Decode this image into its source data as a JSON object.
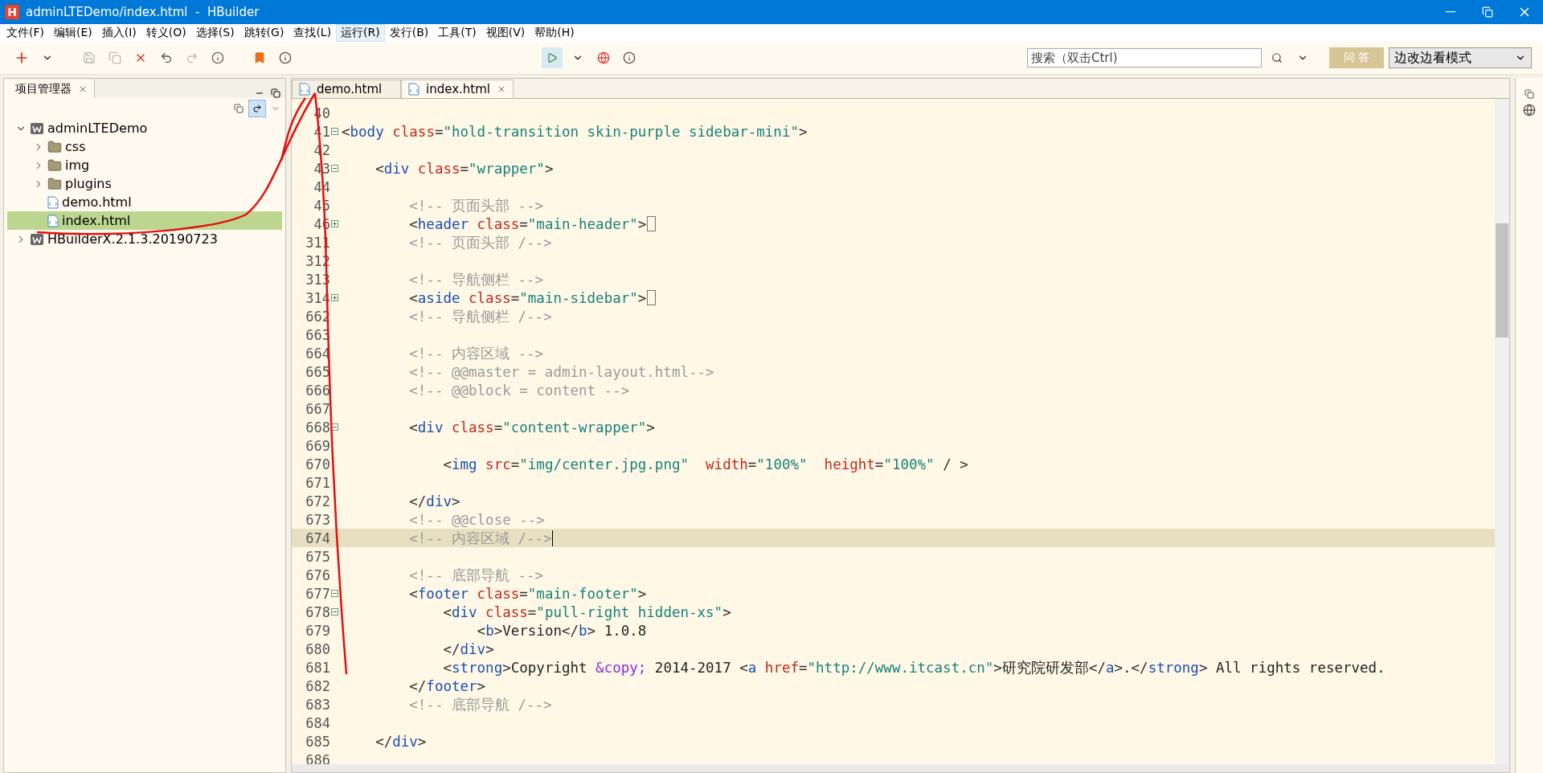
{
  "window": {
    "logo": "H",
    "title": "adminLTEDemo/index.html  -  HBuilder"
  },
  "menu": [
    {
      "label": "文件(F)",
      "selected": false
    },
    {
      "label": "编辑(E)",
      "selected": false
    },
    {
      "label": "插入(I)",
      "selected": false
    },
    {
      "label": "转义(O)",
      "selected": false
    },
    {
      "label": "选择(S)",
      "selected": false
    },
    {
      "label": "跳转(G)",
      "selected": false
    },
    {
      "label": "查找(L)",
      "selected": false
    },
    {
      "label": "运行(R)",
      "selected": true
    },
    {
      "label": "发行(B)",
      "selected": false
    },
    {
      "label": "工具(T)",
      "selected": false
    },
    {
      "label": "视图(V)",
      "selected": false
    },
    {
      "label": "帮助(H)",
      "selected": false
    }
  ],
  "toolbar": {
    "search": {
      "placeholder": "搜索（双击Ctrl)"
    },
    "qa_button": "问 答",
    "mode_select": "边改边看模式"
  },
  "project_panel": {
    "tab": "项目管理器",
    "tree": [
      {
        "label": "adminLTEDemo",
        "kind": "project",
        "expanded": true,
        "selected": false,
        "children": [
          {
            "label": "css",
            "kind": "folder",
            "expanded": false,
            "selected": false
          },
          {
            "label": "img",
            "kind": "folder",
            "expanded": false,
            "selected": false
          },
          {
            "label": "plugins",
            "kind": "folder",
            "expanded": false,
            "selected": false
          },
          {
            "label": "demo.html",
            "kind": "file",
            "selected": false
          },
          {
            "label": "index.html",
            "kind": "file",
            "selected": true
          }
        ]
      },
      {
        "label": "HBuilderX.2.1.3.20190723",
        "kind": "project",
        "expanded": false,
        "selected": false
      }
    ]
  },
  "editor": {
    "tabs": [
      {
        "label": "demo.html",
        "selected": false
      },
      {
        "label": "index.html",
        "selected": true
      }
    ],
    "lines": [
      {
        "number": "40"
      },
      {
        "number": "41",
        "expanded": true,
        "tokens": [
          {
            "kind": "punct",
            "text": "<"
          },
          {
            "kind": "tag",
            "text": "body"
          },
          {
            "kind": "attr",
            "text": " class"
          },
          {
            "kind": "punct",
            "text": "="
          },
          {
            "kind": "string",
            "text": "\"hold-transition skin-purple sidebar-mini\""
          },
          {
            "kind": "punct",
            "text": ">"
          }
        ]
      },
      {
        "number": "42"
      },
      {
        "number": "43",
        "expanded": true,
        "tokens": [
          {
            "kind": "punct",
            "text": "    <"
          },
          {
            "kind": "tag",
            "text": "div"
          },
          {
            "kind": "attr",
            "text": " class"
          },
          {
            "kind": "punct",
            "text": "="
          },
          {
            "kind": "string",
            "text": "\"wrapper\""
          },
          {
            "kind": "punct",
            "text": ">"
          }
        ]
      },
      {
        "number": "44"
      },
      {
        "number": "45",
        "tokens": [
          {
            "kind": "comment",
            "text": "        <!-- 页面头部 -->"
          }
        ]
      },
      {
        "number": "46",
        "expanded": false,
        "tokens": [
          {
            "kind": "punct",
            "text": "        <"
          },
          {
            "kind": "tag",
            "text": "header"
          },
          {
            "kind": "attr",
            "text": " class"
          },
          {
            "kind": "punct",
            "text": "="
          },
          {
            "kind": "string",
            "text": "\"main-header\""
          },
          {
            "kind": "punct",
            "text": ">"
          }
        ]
      },
      {
        "number": "311",
        "tokens": [
          {
            "kind": "comment",
            "text": "        <!-- 页面头部 /-->"
          }
        ]
      },
      {
        "number": "312"
      },
      {
        "number": "313",
        "tokens": [
          {
            "kind": "comment",
            "text": "        <!-- 导航侧栏 -->"
          }
        ]
      },
      {
        "number": "314",
        "expanded": false,
        "tokens": [
          {
            "kind": "punct",
            "text": "        <"
          },
          {
            "kind": "tag",
            "text": "aside"
          },
          {
            "kind": "attr",
            "text": " class"
          },
          {
            "kind": "punct",
            "text": "="
          },
          {
            "kind": "string",
            "text": "\"main-sidebar\""
          },
          {
            "kind": "punct",
            "text": ">"
          }
        ]
      },
      {
        "number": "662",
        "tokens": [
          {
            "kind": "comment",
            "text": "        <!-- 导航侧栏 /-->"
          }
        ]
      },
      {
        "number": "663"
      },
      {
        "number": "664",
        "tokens": [
          {
            "kind": "comment",
            "text": "        <!-- 内容区域 -->"
          }
        ]
      },
      {
        "number": "665",
        "tokens": [
          {
            "kind": "comment",
            "text": "        <!-- @@master = admin-layout.html-->"
          }
        ]
      },
      {
        "number": "666",
        "tokens": [
          {
            "kind": "comment",
            "text": "        <!-- @@block = content -->"
          }
        ]
      },
      {
        "number": "667"
      },
      {
        "number": "668",
        "expanded": true,
        "tokens": [
          {
            "kind": "punct",
            "text": "        <"
          },
          {
            "kind": "tag",
            "text": "div"
          },
          {
            "kind": "attr",
            "text": " class"
          },
          {
            "kind": "punct",
            "text": "="
          },
          {
            "kind": "string",
            "text": "\"content-wrapper\""
          },
          {
            "kind": "punct",
            "text": ">"
          }
        ]
      },
      {
        "number": "669"
      },
      {
        "number": "670",
        "tokens": [
          {
            "kind": "punct",
            "text": "            <"
          },
          {
            "kind": "tag",
            "text": "img"
          },
          {
            "kind": "attr",
            "text": " src"
          },
          {
            "kind": "punct",
            "text": "="
          },
          {
            "kind": "string",
            "text": "\"img/center.jpg.png\""
          },
          {
            "kind": "attr",
            "text": "  width"
          },
          {
            "kind": "punct",
            "text": "="
          },
          {
            "kind": "string",
            "text": "\"100%\""
          },
          {
            "kind": "attr",
            "text": "  height"
          },
          {
            "kind": "punct",
            "text": "="
          },
          {
            "kind": "string",
            "text": "\"100%\""
          },
          {
            "kind": "punct",
            "text": " / >"
          }
        ]
      },
      {
        "number": "671"
      },
      {
        "number": "672",
        "tokens": [
          {
            "kind": "punct",
            "text": "        </"
          },
          {
            "kind": "tag",
            "text": "div"
          },
          {
            "kind": "punct",
            "text": ">"
          }
        ]
      },
      {
        "number": "673",
        "tokens": [
          {
            "kind": "comment",
            "text": "        <!-- @@close -->"
          }
        ]
      },
      {
        "number": "674",
        "current": true,
        "cursor": true,
        "tokens": [
          {
            "kind": "comment",
            "text": "        <!-- 内容区域 /-->"
          }
        ]
      },
      {
        "number": "675"
      },
      {
        "number": "676",
        "tokens": [
          {
            "kind": "comment",
            "text": "        <!-- 底部导航 -->"
          }
        ]
      },
      {
        "number": "677",
        "expanded": true,
        "tokens": [
          {
            "kind": "punct",
            "text": "        <"
          },
          {
            "kind": "tag",
            "text": "footer"
          },
          {
            "kind": "attr",
            "text": " class"
          },
          {
            "kind": "punct",
            "text": "="
          },
          {
            "kind": "string",
            "text": "\"main-footer\""
          },
          {
            "kind": "punct",
            "text": ">"
          }
        ]
      },
      {
        "number": "678",
        "expanded": true,
        "tokens": [
          {
            "kind": "punct",
            "text": "            <"
          },
          {
            "kind": "tag",
            "text": "div"
          },
          {
            "kind": "attr",
            "text": " class"
          },
          {
            "kind": "punct",
            "text": "="
          },
          {
            "kind": "string",
            "text": "\"pull-right hidden-xs\""
          },
          {
            "kind": "punct",
            "text": ">"
          }
        ]
      },
      {
        "number": "679",
        "tokens": [
          {
            "kind": "punct",
            "text": "                <"
          },
          {
            "kind": "tag",
            "text": "b"
          },
          {
            "kind": "punct",
            "text": ">"
          },
          {
            "kind": "plain",
            "text": "Version"
          },
          {
            "kind": "punct",
            "text": "</"
          },
          {
            "kind": "tag",
            "text": "b"
          },
          {
            "kind": "punct",
            "text": ">"
          },
          {
            "kind": "plain",
            "text": " 1.0.8"
          }
        ]
      },
      {
        "number": "680",
        "tokens": [
          {
            "kind": "punct",
            "text": "            </"
          },
          {
            "kind": "tag",
            "text": "div"
          },
          {
            "kind": "punct",
            "text": ">"
          }
        ]
      },
      {
        "number": "681",
        "tokens": [
          {
            "kind": "punct",
            "text": "            <"
          },
          {
            "kind": "tag",
            "text": "strong"
          },
          {
            "kind": "punct",
            "text": ">"
          },
          {
            "kind": "plain",
            "text": "Copyright "
          },
          {
            "kind": "entity",
            "text": "&copy;"
          },
          {
            "kind": "plain",
            "text": " 2014-2017 "
          },
          {
            "kind": "punct",
            "text": "<"
          },
          {
            "kind": "tag",
            "text": "a"
          },
          {
            "kind": "attr",
            "text": " href"
          },
          {
            "kind": "punct",
            "text": "="
          },
          {
            "kind": "string",
            "text": "\"http://www.itcast.cn\""
          },
          {
            "kind": "punct",
            "text": ">"
          },
          {
            "kind": "plain",
            "text": "研究院研发部"
          },
          {
            "kind": "punct",
            "text": "</"
          },
          {
            "kind": "tag",
            "text": "a"
          },
          {
            "kind": "punct",
            "text": ">.</"
          },
          {
            "kind": "tag",
            "text": "strong"
          },
          {
            "kind": "punct",
            "text": ">"
          },
          {
            "kind": "plain",
            "text": " All rights reserved."
          }
        ]
      },
      {
        "number": "682",
        "tokens": [
          {
            "kind": "punct",
            "text": "        </"
          },
          {
            "kind": "tag",
            "text": "footer"
          },
          {
            "kind": "punct",
            "text": ">"
          }
        ]
      },
      {
        "number": "683",
        "tokens": [
          {
            "kind": "comment",
            "text": "        <!-- 底部导航 /-->"
          }
        ]
      },
      {
        "number": "684"
      },
      {
        "number": "685",
        "tokens": [
          {
            "kind": "punct",
            "text": "    </"
          },
          {
            "kind": "tag",
            "text": "div"
          },
          {
            "kind": "punct",
            "text": ">"
          }
        ]
      },
      {
        "number": "686"
      }
    ]
  }
}
